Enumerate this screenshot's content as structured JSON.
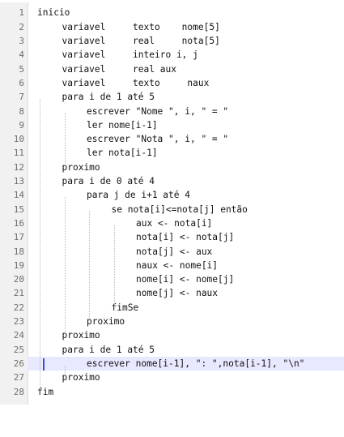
{
  "editor": {
    "lines": [
      {
        "n": "1",
        "text": "inicio",
        "indent": 0
      },
      {
        "n": "2",
        "text": "variavel     texto    nome[5]",
        "indent": 1
      },
      {
        "n": "3",
        "text": "variavel     real     nota[5]",
        "indent": 1
      },
      {
        "n": "4",
        "text": "variavel     inteiro i, j",
        "indent": 1
      },
      {
        "n": "5",
        "text": "variavel     real aux",
        "indent": 1
      },
      {
        "n": "6",
        "text": "variavel     texto     naux",
        "indent": 1
      },
      {
        "n": "7",
        "text": "para i de 1 até 5",
        "indent": 1
      },
      {
        "n": "8",
        "text": "escrever \"Nome \", i, \" = \"",
        "indent": 2
      },
      {
        "n": "9",
        "text": "ler nome[i-1]",
        "indent": 2
      },
      {
        "n": "10",
        "text": "escrever \"Nota \", i, \" = \"",
        "indent": 2
      },
      {
        "n": "11",
        "text": "ler nota[i-1]",
        "indent": 2
      },
      {
        "n": "12",
        "text": "proximo",
        "indent": 1
      },
      {
        "n": "13",
        "text": "para i de 0 até 4",
        "indent": 1
      },
      {
        "n": "14",
        "text": "para j de i+1 até 4",
        "indent": 2
      },
      {
        "n": "15",
        "text": "se nota[i]<=nota[j] então",
        "indent": 3
      },
      {
        "n": "16",
        "text": "aux <- nota[i]",
        "indent": 4
      },
      {
        "n": "17",
        "text": "nota[i] <- nota[j]",
        "indent": 4
      },
      {
        "n": "18",
        "text": "nota[j] <- aux",
        "indent": 4
      },
      {
        "n": "19",
        "text": "naux <- nome[i]",
        "indent": 4
      },
      {
        "n": "20",
        "text": "nome[i] <- nome[j]",
        "indent": 4
      },
      {
        "n": "21",
        "text": "nome[j] <- naux",
        "indent": 4
      },
      {
        "n": "22",
        "text": "fimSe",
        "indent": 3
      },
      {
        "n": "23",
        "text": "proximo",
        "indent": 2
      },
      {
        "n": "24",
        "text": "proximo",
        "indent": 1
      },
      {
        "n": "25",
        "text": "para i de 1 até 5",
        "indent": 1
      },
      {
        "n": "26",
        "text": "escrever nome[i-1], \": \",nota[i-1], \"\\n\"",
        "indent": 2
      },
      {
        "n": "27",
        "text": "proximo",
        "indent": 1
      },
      {
        "n": "28",
        "text": "fim",
        "indent": 0
      }
    ],
    "current_line": 26,
    "colors": {
      "gutter_bg": "#f1f1f1",
      "current_line_bg": "#e8e8ff",
      "caret": "#3355cc",
      "spell_underline": "#d00000"
    }
  }
}
